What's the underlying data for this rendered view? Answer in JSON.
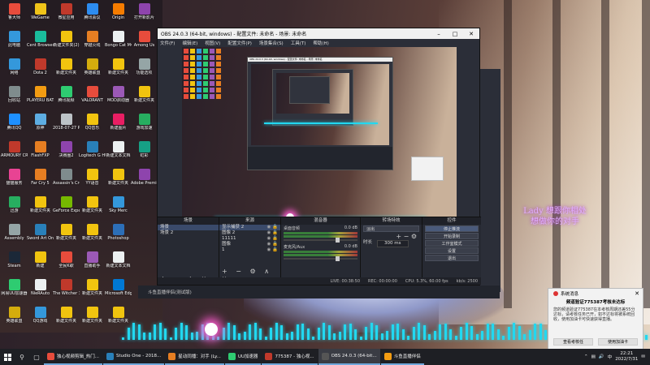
{
  "desktop_icons": [
    {
      "label": "鲁大师",
      "color": "#e74c3c"
    },
    {
      "label": "WeGame",
      "color": "#f0c419"
    },
    {
      "label": "微星应用",
      "color": "#c0392b"
    },
    {
      "label": "腾讯会议",
      "color": "#2d8cf0"
    },
    {
      "label": "Origin",
      "color": "#f57c00"
    },
    {
      "label": "打开新影片",
      "color": "#8e44ad"
    },
    {
      "label": "此电脑",
      "color": "#3498db"
    },
    {
      "label": "Cent Browser",
      "color": "#1abc9c"
    },
    {
      "label": "新建文件夹(2)",
      "color": "#f1c40f"
    },
    {
      "label": "穿越火线",
      "color": "#e67e22"
    },
    {
      "label": "Bongo Cat Mver",
      "color": "#ecf0f1"
    },
    {
      "label": "Among Us",
      "color": "#e74c3c"
    },
    {
      "label": "网络",
      "color": "#3498db"
    },
    {
      "label": "Dota 2",
      "color": "#c0392b"
    },
    {
      "label": "新建文件夹",
      "color": "#f1c40f"
    },
    {
      "label": "英雄联盟",
      "color": "#d4ac0d"
    },
    {
      "label": "新建文件夹",
      "color": "#f1c40f"
    },
    {
      "label": "功能选项",
      "color": "#95a5a6"
    },
    {
      "label": "回收站",
      "color": "#7f8c8d"
    },
    {
      "label": "PLAYERU BATTLEGR",
      "color": "#f39c12"
    },
    {
      "label": "腾讯视频",
      "color": "#2ecc71"
    },
    {
      "label": "VALORANT",
      "color": "#e74c3c"
    },
    {
      "label": "MOD启动器",
      "color": "#9b59b6"
    },
    {
      "label": "新建文件夹",
      "color": "#f1c40f"
    },
    {
      "label": "腾讯QQ",
      "color": "#1e90ff"
    },
    {
      "label": "原神",
      "color": "#5dade2"
    },
    {
      "label": "2018-07-27 PreSonus",
      "color": "#bdc3c7"
    },
    {
      "label": "QQ音乐",
      "color": "#f1c40f"
    },
    {
      "label": "新建图片",
      "color": "#e91e63"
    },
    {
      "label": "游戏加速",
      "color": "#27ae60"
    },
    {
      "label": "ARMOURY CRATE",
      "color": "#c0392b"
    },
    {
      "label": "FlashFXP",
      "color": "#e67e22"
    },
    {
      "label": "决赛圈2",
      "color": "#8e44ad"
    },
    {
      "label": "Logitech G HUB",
      "color": "#2980b9"
    },
    {
      "label": "新建文本文档",
      "color": "#ecf0f1"
    },
    {
      "label": "虹彩",
      "color": "#16a085"
    },
    {
      "label": "猫猫服务",
      "color": "#e84393"
    },
    {
      "label": "Far Cry 5",
      "color": "#e67e22"
    },
    {
      "label": "Assassin's Creed",
      "color": "#7f8c8d"
    },
    {
      "label": "YY语音",
      "color": "#f1c40f"
    },
    {
      "label": "新建文件夹",
      "color": "#f1c40f"
    },
    {
      "label": "Adobe Premiere",
      "color": "#8e44ad"
    },
    {
      "label": "迅游",
      "color": "#27ae60"
    },
    {
      "label": "新建文件夹",
      "color": "#f1c40f"
    },
    {
      "label": "GeForce Experience",
      "color": "#76b900"
    },
    {
      "label": "新建文件夹",
      "color": "#f1c40f"
    },
    {
      "label": "Sky Merc",
      "color": "#3498db"
    },
    {
      "label": "",
      "color": "#000000"
    },
    {
      "label": "Assembly",
      "color": "#95a5a6"
    },
    {
      "label": "Sword Art Online",
      "color": "#2980b9"
    },
    {
      "label": "新建文件夹",
      "color": "#f1c40f"
    },
    {
      "label": "新建文件夹",
      "color": "#f1c40f"
    },
    {
      "label": "Photoshop",
      "color": "#2c6fb8"
    },
    {
      "label": "",
      "color": "#000000"
    },
    {
      "label": "Steam",
      "color": "#1b2838"
    },
    {
      "label": "新建",
      "color": "#f1c40f"
    },
    {
      "label": "全民K歌",
      "color": "#e74c3c"
    },
    {
      "label": "直播助手",
      "color": "#9b59b6"
    },
    {
      "label": "新建文本文档",
      "color": "#ecf0f1"
    },
    {
      "label": "",
      "color": "#000000"
    },
    {
      "label": "网易UU加速器",
      "color": "#2ecc71"
    },
    {
      "label": "NieRAuto",
      "color": "#ecf0f1"
    },
    {
      "label": "The Witcher 3 Wild Hunt",
      "color": "#c0392b"
    },
    {
      "label": "新建文件夹",
      "color": "#f1c40f"
    },
    {
      "label": "Microsoft Edge",
      "color": "#0078d4"
    },
    {
      "label": "",
      "color": "#000000"
    },
    {
      "label": "英雄联盟",
      "color": "#d4ac0d"
    },
    {
      "label": "QQ游戏",
      "color": "#3498db"
    },
    {
      "label": "新建文件夹",
      "color": "#f1c40f"
    },
    {
      "label": "新建文件夹",
      "color": "#f1c40f"
    },
    {
      "label": "新建文件夹",
      "color": "#f1c40f"
    },
    {
      "label": "",
      "color": "#000000"
    }
  ],
  "obs": {
    "title": "OBS 24.0.3 (64-bit, windows) - 配置文件: 未命名 - 场景: 未命名",
    "menu": [
      "文件(F)",
      "编辑(E)",
      "视图(V)",
      "配置文件(P)",
      "场景集合(S)",
      "工具(T)",
      "帮助(H)"
    ],
    "docks": {
      "scenes": {
        "title": "场景",
        "items": [
          "场景",
          "场景 2"
        ]
      },
      "sources": {
        "title": "来源",
        "items": [
          "显示捕获 2",
          "图像 2",
          "11111",
          "图像",
          "1"
        ]
      },
      "mixer": {
        "title": "混音器",
        "channels": [
          {
            "name": "桌面音频",
            "db": "0.0 dB"
          },
          {
            "name": "麦克风/Aux",
            "db": "0.0 dB"
          }
        ]
      },
      "transitions": {
        "title": "转场特效",
        "type": "淡出",
        "duration_label": "时长",
        "duration": "300 ms"
      },
      "controls": {
        "title": "控件",
        "buttons": [
          "停止推流",
          "开始录制",
          "工作室模式",
          "设置",
          "退出"
        ]
      }
    },
    "status": {
      "live": "LIVE: 00:38:50",
      "rec": "REC: 00:00:00",
      "cpu": "CPU: 5.3%, 60.00 fps",
      "dropped": "kb/s: 2500"
    }
  },
  "nested_title": "OBS 24.0.3 (64-bit, windows) - 配置文件: 未命名 - 场景: 未命名",
  "lyrics": [
    "Lady 想跟你相处",
    "想做你的对手"
  ],
  "notification": {
    "header": "系统消息",
    "title": "频道验证775387考核未达标",
    "body": "您的频道验证775387在本考核周期还差55分达标，请考核任务已开，如不达标将被系统回收，使用加油卡可快速获得直播。",
    "btn1": "查看考核任",
    "btn2": "使用加油卡"
  },
  "taskbar": {
    "apps": [
      {
        "label": "独心视频剪辑_热门...",
        "color": "#e74c3c"
      },
      {
        "label": "Studio One - 2018...",
        "color": "#2980b9"
      },
      {
        "label": "星动同播：对手 (Ly...",
        "color": "#e67e22"
      },
      {
        "label": "UU加速器",
        "color": "#2ecc71"
      },
      {
        "label": "775387 - 独心视...",
        "color": "#c0392b"
      },
      {
        "label": "OBS 24.0.3 (64-bit...",
        "color": "#555555"
      },
      {
        "label": "斗鱼直播伴侣",
        "color": "#f39c12"
      }
    ],
    "time": "22:21",
    "date": "2022/7/31",
    "lang": "中"
  },
  "obs_tray": "斗鱼直播伴侣(测试版)"
}
